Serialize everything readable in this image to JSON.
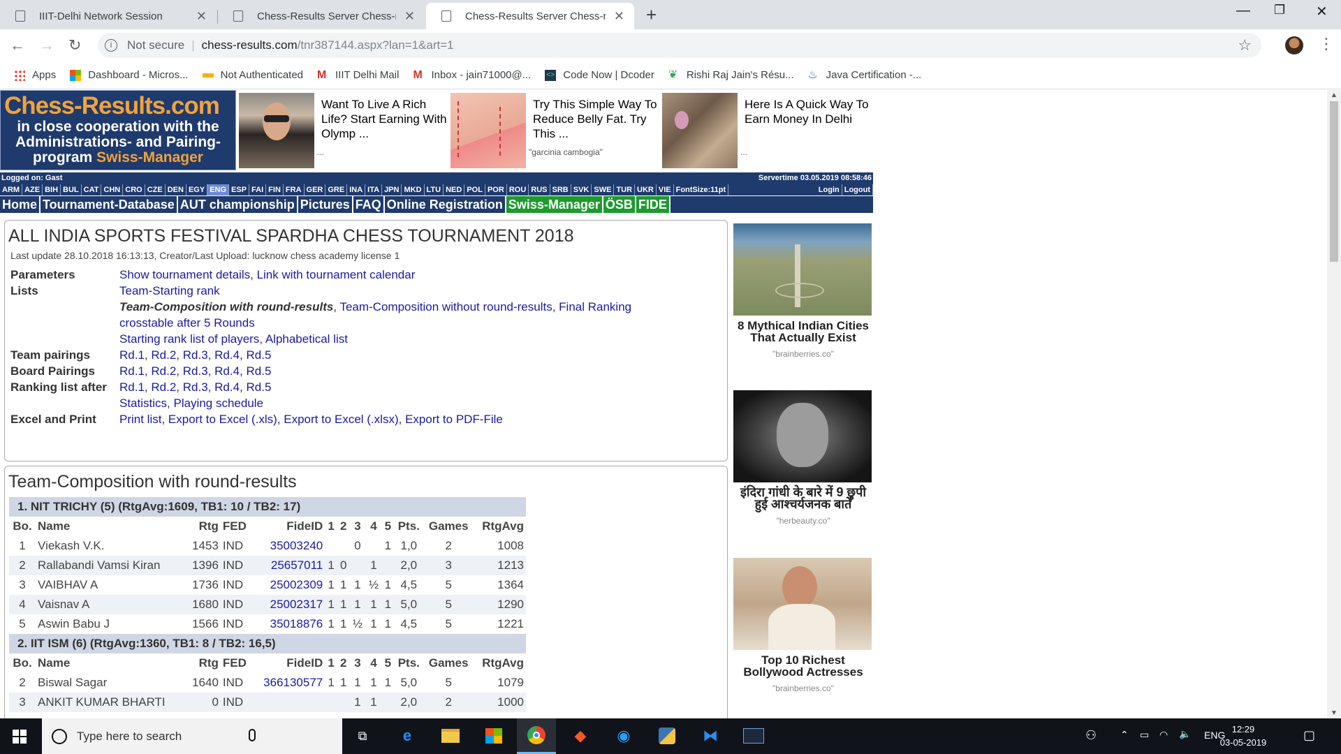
{
  "browser": {
    "tabs": [
      {
        "title": "IIIT-Delhi Network Session"
      },
      {
        "title": "Chess-Results Server Chess-resul"
      },
      {
        "title": "Chess-Results Server Chess-resul"
      }
    ],
    "address": {
      "security": "Not secure",
      "host": "chess-results.com",
      "path": "/tnr387144.aspx?lan=1&art=1"
    },
    "bookmarks": [
      {
        "label": "Apps",
        "icon": "apps-grid-icon"
      },
      {
        "label": "Dashboard - Micros...",
        "icon": "microsoft-logo-icon"
      },
      {
        "label": "Not Authenticated",
        "icon": "site-icon"
      },
      {
        "label": "IIIT Delhi Mail",
        "icon": "gmail-icon"
      },
      {
        "label": "Inbox - jain71000@...",
        "icon": "gmail-icon"
      },
      {
        "label": "Code Now | Dcoder",
        "icon": "dcoder-icon"
      },
      {
        "label": "Rishi Raj Jain's Résu...",
        "icon": "leaf-icon"
      },
      {
        "label": "Java Certification -...",
        "icon": "java-icon"
      }
    ]
  },
  "site": {
    "logo_title": "Chess-Results.com",
    "logo_sub1": "in close cooperation with the",
    "logo_sub2": "Administrations- and Pairing-",
    "logo_sub3": "program",
    "logo_sub3b": "Swiss-Manager",
    "logged_on": "Logged on: Gast",
    "servertime": "Servertime 03.05.2019 08:58:46",
    "languages": [
      "ARM",
      "AZE",
      "BIH",
      "BUL",
      "CAT",
      "CHN",
      "CRO",
      "CZE",
      "DEN",
      "EGY",
      "ENG",
      "ESP",
      "FAI",
      "FIN",
      "FRA",
      "GER",
      "GRE",
      "INA",
      "ITA",
      "JPN",
      "MKD",
      "LTU",
      "NED",
      "POL",
      "POR",
      "ROU",
      "RUS",
      "SRB",
      "SVK",
      "SWE",
      "TUR",
      "UKR",
      "VIE",
      "FontSize:11pt"
    ],
    "selected_language": "ENG",
    "login": "Login",
    "logout": "Logout",
    "menu": [
      "Home",
      "Tournament-Database",
      "AUT championship",
      "Pictures",
      "FAQ",
      "Online Registration",
      "Swiss-Manager",
      "ÖSB",
      "FIDE"
    ]
  },
  "ads": [
    {
      "text": "Want To Live A Rich Life? Start Earning With Olymp ...",
      "source": "..."
    },
    {
      "text": "Try This Simple Way To Reduce Belly Fat. Try This ...",
      "source": "\"garcinia cambogia\""
    },
    {
      "text": "Here Is A Quick Way To Earn Money In Delhi",
      "source": "..."
    }
  ],
  "side_ads": [
    {
      "title": "8 Mythical Indian Cities That Actually Exist",
      "source": "\"brainberries.co\""
    },
    {
      "title": "इंदिरा गांधी के बारे में 9 छुपी हुई आश्चर्यजनक बातें",
      "source": "\"herbeauty.co\""
    },
    {
      "title": "Top 10 Richest Bollywood Actresses",
      "source": "\"brainberries.co\""
    }
  ],
  "tournament": {
    "title": "ALL INDIA SPORTS FESTIVAL SPARDHA CHESS TOURNAMENT 2018",
    "last_update": "Last update 28.10.2018 16:13:13, Creator/Last Upload: lucknow chess academy license 1",
    "rows": [
      {
        "label": "Parameters",
        "links": [
          "Show tournament details",
          "Link with tournament calendar"
        ]
      },
      {
        "label": "Lists",
        "links": [
          "Team-Starting rank"
        ]
      },
      {
        "label": "",
        "current": "Team-Composition with round-results",
        "links": [
          "Team-Composition without round-results",
          "Final Ranking crosstable after 5 Rounds"
        ]
      },
      {
        "label": "",
        "links": [
          "Starting rank list of players",
          "Alphabetical list"
        ]
      },
      {
        "label": "Team pairings",
        "links": [
          "Rd.1",
          "Rd.2",
          "Rd.3",
          "Rd.4",
          "Rd.5"
        ]
      },
      {
        "label": "Board Pairings",
        "links": [
          "Rd.1",
          "Rd.2",
          "Rd.3",
          "Rd.4",
          "Rd.5"
        ]
      },
      {
        "label": "Ranking list after",
        "links": [
          "Rd.1",
          "Rd.2",
          "Rd.3",
          "Rd.4",
          "Rd.5"
        ]
      },
      {
        "label": "",
        "links": [
          "Statistics",
          "Playing schedule"
        ]
      },
      {
        "label": "Excel and Print",
        "links": [
          "Print list",
          "Export to Excel (.xls)",
          "Export to Excel (.xlsx)",
          "Export to PDF-File"
        ]
      }
    ]
  },
  "composition": {
    "heading": "Team-Composition with round-results",
    "columns": [
      "Bo.",
      "Name",
      "Rtg",
      "FED",
      "FideID",
      "1",
      "2",
      "3",
      "4",
      "5",
      "Pts.",
      "Games",
      "RtgAvg"
    ],
    "teams": [
      {
        "header": "1. NIT TRICHY (5) (RtgAvg:1609, TB1: 10 / TB2: 17)",
        "players": [
          [
            "1",
            "Viekash V.K.",
            "1453",
            "IND",
            "35003240",
            "",
            "",
            "0",
            "",
            "1",
            "1,0",
            "2",
            "1008"
          ],
          [
            "2",
            "Rallabandi Vamsi Kiran",
            "1396",
            "IND",
            "25657011",
            "1",
            "0",
            "",
            "1",
            "",
            "2,0",
            "3",
            "1213"
          ],
          [
            "3",
            "VAIBHAV A",
            "1736",
            "IND",
            "25002309",
            "1",
            "1",
            "1",
            "½",
            "1",
            "4,5",
            "5",
            "1364"
          ],
          [
            "4",
            "Vaisnav A",
            "1680",
            "IND",
            "25002317",
            "1",
            "1",
            "1",
            "1",
            "1",
            "5,0",
            "5",
            "1290"
          ],
          [
            "5",
            "Aswin Babu J",
            "1566",
            "IND",
            "35018876",
            "1",
            "1",
            "½",
            "1",
            "1",
            "4,5",
            "5",
            "1221"
          ]
        ]
      },
      {
        "header": "2. IIT ISM (6) (RtgAvg:1360, TB1: 8 / TB2: 16,5)",
        "players": [
          [
            "2",
            "Biswal Sagar",
            "1640",
            "IND",
            "366130577",
            "1",
            "1",
            "1",
            "1",
            "1",
            "5,0",
            "5",
            "1079"
          ],
          [
            "3",
            "ANKIT KUMAR BHARTI",
            "0",
            "IND",
            "",
            "",
            "",
            "1",
            "1",
            "",
            "2,0",
            "2",
            "1000"
          ]
        ]
      }
    ]
  },
  "taskbar": {
    "search_placeholder": "Type here to search",
    "language": "ENG",
    "time": "12:29",
    "date": "03-05-2019"
  }
}
